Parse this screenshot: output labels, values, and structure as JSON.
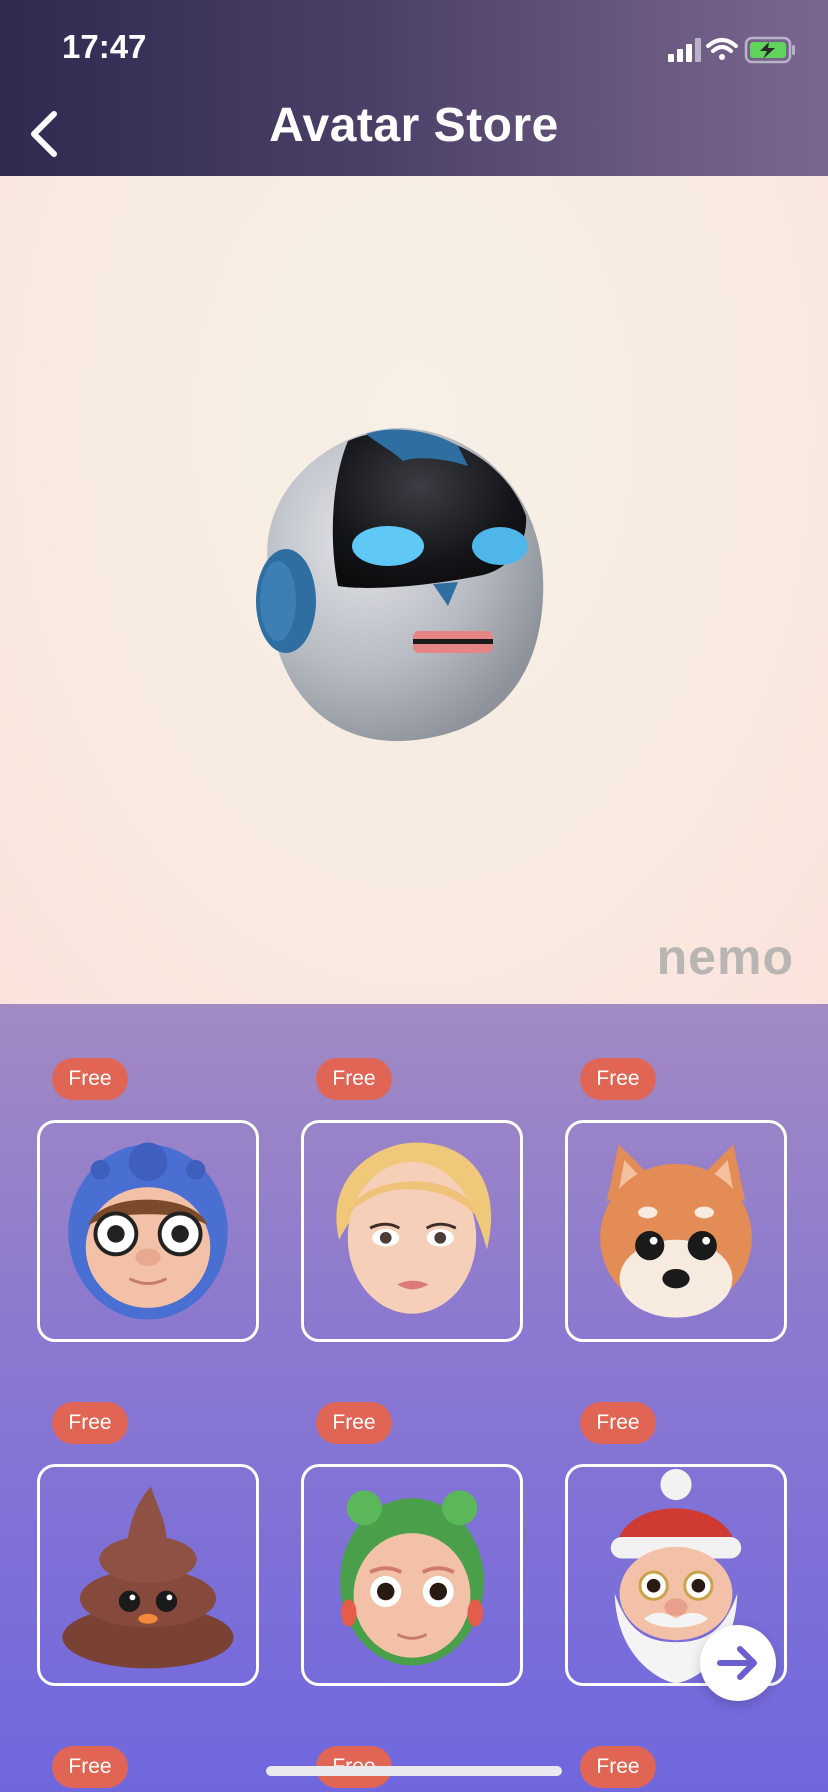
{
  "status_bar": {
    "time": "17:47"
  },
  "header": {
    "title": "Avatar Store"
  },
  "preview": {
    "watermark": "nemo",
    "avatar": "robot-head"
  },
  "grid": {
    "items": [
      {
        "badge": "Free",
        "avatar": "blue-hood-glasses-boy"
      },
      {
        "badge": "Free",
        "avatar": "blonde-woman"
      },
      {
        "badge": "Free",
        "avatar": "shiba-dog"
      },
      {
        "badge": "Free",
        "avatar": "poop"
      },
      {
        "badge": "Free",
        "avatar": "frog-hat-girl"
      },
      {
        "badge": "Free",
        "avatar": "santa-claus"
      },
      {
        "badge": "Free"
      },
      {
        "badge": "Free"
      },
      {
        "badge": "Free"
      }
    ]
  },
  "colors": {
    "badge": "#e06555",
    "header": "#3a3358",
    "grid_bg": "#8c79cf",
    "accent": "#6b5fd0"
  },
  "icons": {
    "back": "chevron-left-icon",
    "next": "arrow-right-icon"
  }
}
